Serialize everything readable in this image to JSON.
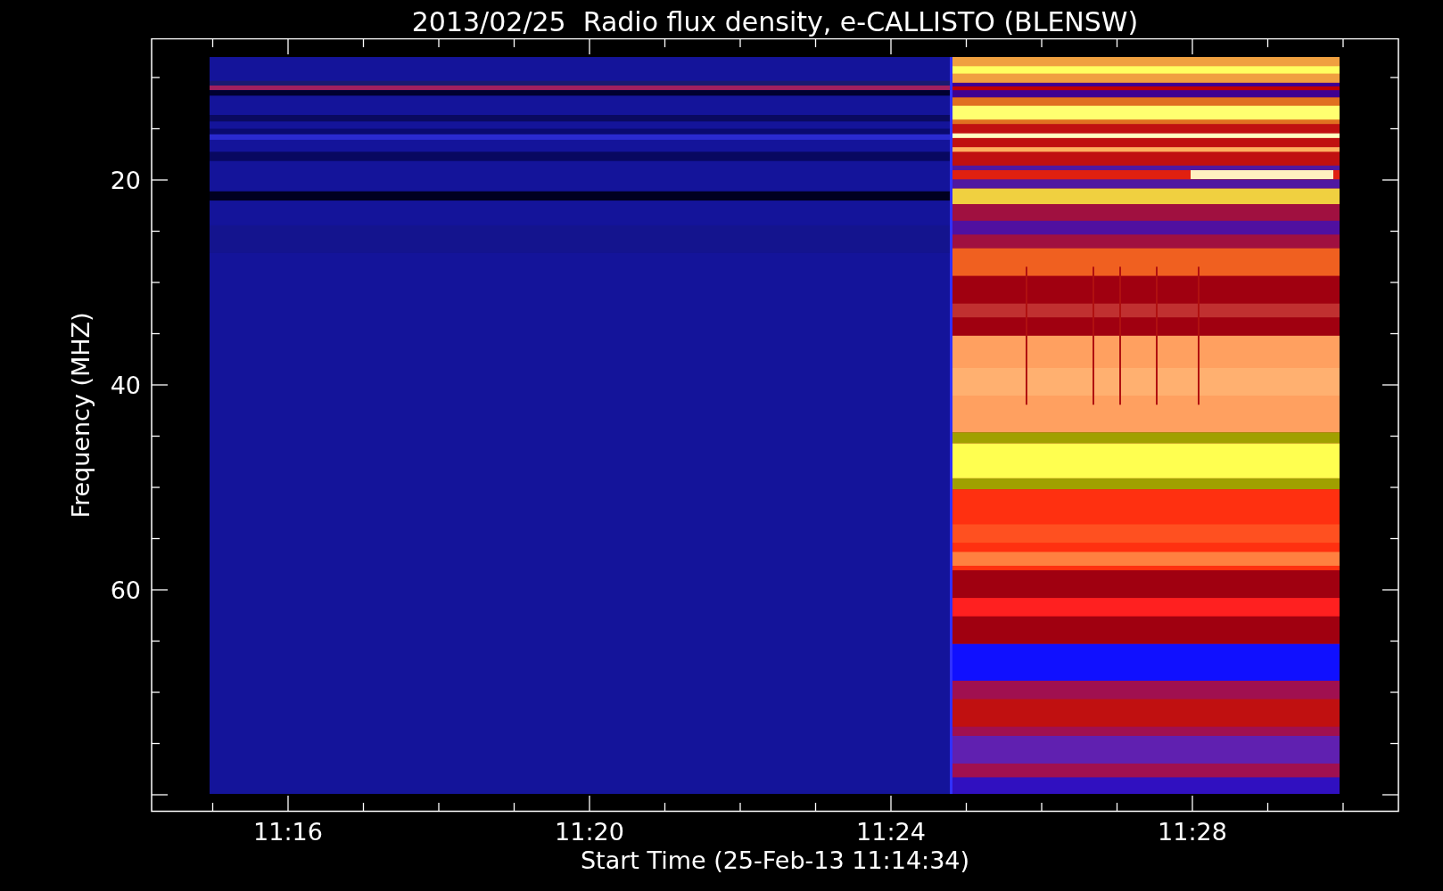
{
  "title": "2013/02/25  Radio flux density, e-CALLISTO (BLENSW)",
  "chart": {
    "ylabel": "Frequency (MHZ)",
    "xlabel": "Start Time (25-Feb-13 11:14:34)",
    "yticks": [
      "20",
      "40",
      "60"
    ],
    "xticks": [
      "11:16",
      "11:20",
      "11:24",
      "11:28"
    ]
  }
}
